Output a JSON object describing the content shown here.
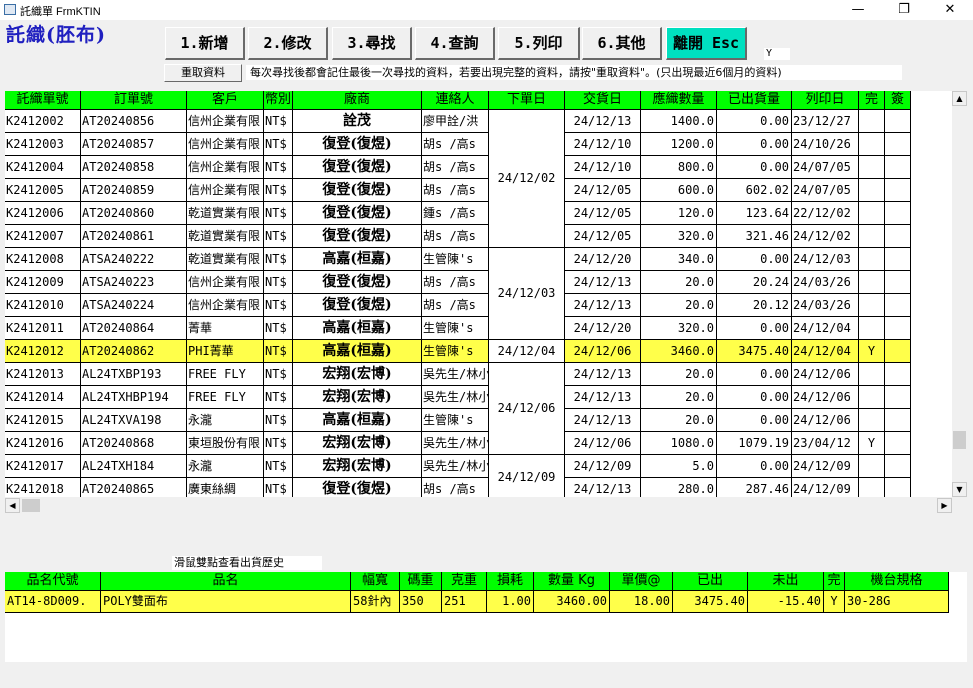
{
  "window": {
    "title": "託織單 FrmKTIN",
    "minimize": "—",
    "restore": "❐",
    "close": "✕"
  },
  "form_title": "託織(胚布)",
  "toolbar": {
    "buttons": [
      "1.新增",
      "2.修改",
      "3.尋找",
      "4.查詢",
      "5.列印",
      "6.其他",
      "離開 Esc"
    ],
    "y_label": "Y",
    "reload_label": "重取資料",
    "notice": "每次尋找後都會記住最後一次尋找的資料，若要出現完整的資料，請按\"重取資料\"。(只出現最近6個月的資料)"
  },
  "grid": {
    "headers": [
      "託織單號",
      "訂單號",
      "客戶",
      "幣別",
      "廠商",
      "連絡人",
      "下單日",
      "交貨日",
      "應織數量",
      "已出貨量",
      "列印日",
      "完",
      "簽"
    ],
    "order_date_groups": [
      {
        "date": "24/12/02",
        "start": 0,
        "count": 6
      },
      {
        "date": "24/12/03",
        "start": 6,
        "count": 4
      },
      {
        "date": "24/12/04",
        "start": 10,
        "count": 1
      },
      {
        "date": "24/12/06",
        "start": 11,
        "count": 4
      },
      {
        "date": "24/12/09",
        "start": 15,
        "count": 2
      }
    ],
    "rows": [
      {
        "no": "K2412002",
        "order": "AT20240856",
        "customer": "信州企業有限",
        "currency": "NT$",
        "factory": "詮茂",
        "contact": "廖甲詮/洪",
        "delivery": "24/12/13",
        "qty": "1400.0",
        "shipped": "0.00",
        "printed": "23/12/27",
        "done": "",
        "sign": ""
      },
      {
        "no": "K2412003",
        "order": "AT20240857",
        "customer": "信州企業有限",
        "currency": "NT$",
        "factory": "復登(復煜)",
        "contact": "胡s /高s",
        "delivery": "24/12/10",
        "qty": "1200.0",
        "shipped": "0.00",
        "printed": "24/10/26",
        "done": "",
        "sign": ""
      },
      {
        "no": "K2412004",
        "order": "AT20240858",
        "customer": "信州企業有限",
        "currency": "NT$",
        "factory": "復登(復煜)",
        "contact": "胡s /高s",
        "delivery": "24/12/10",
        "qty": "800.0",
        "shipped": "0.00",
        "printed": "24/07/05",
        "done": "",
        "sign": ""
      },
      {
        "no": "K2412005",
        "order": "AT20240859",
        "customer": "信州企業有限",
        "currency": "NT$",
        "factory": "復登(復煜)",
        "contact": "胡s /高s",
        "delivery": "24/12/05",
        "qty": "600.0",
        "shipped": "602.02",
        "printed": "24/07/05",
        "done": "",
        "sign": ""
      },
      {
        "no": "K2412006",
        "order": "AT20240860",
        "customer": "乾道實業有限",
        "currency": "NT$",
        "factory": "復登(復煜)",
        "contact": "鍾s /高s",
        "delivery": "24/12/05",
        "qty": "120.0",
        "shipped": "123.64",
        "printed": "22/12/02",
        "done": "",
        "sign": ""
      },
      {
        "no": "K2412007",
        "order": "AT20240861",
        "customer": "乾道實業有限",
        "currency": "NT$",
        "factory": "復登(復煜)",
        "contact": "胡s /高s",
        "delivery": "24/12/05",
        "qty": "320.0",
        "shipped": "321.46",
        "printed": "24/12/02",
        "done": "",
        "sign": ""
      },
      {
        "no": "K2412008",
        "order": "ATSA240222",
        "customer": "乾道實業有限",
        "currency": "NT$",
        "factory": "高嘉(桓嘉)",
        "contact": "生管陳's",
        "delivery": "24/12/20",
        "qty": "340.0",
        "shipped": "0.00",
        "printed": "24/12/03",
        "done": "",
        "sign": ""
      },
      {
        "no": "K2412009",
        "order": "ATSA240223",
        "customer": "信州企業有限",
        "currency": "NT$",
        "factory": "復登(復煜)",
        "contact": "胡s /高s",
        "delivery": "24/12/13",
        "qty": "20.0",
        "shipped": "20.24",
        "printed": "24/03/26",
        "done": "",
        "sign": ""
      },
      {
        "no": "K2412010",
        "order": "ATSA240224",
        "customer": "信州企業有限",
        "currency": "NT$",
        "factory": "復登(復煜)",
        "contact": "胡s /高s",
        "delivery": "24/12/13",
        "qty": "20.0",
        "shipped": "20.12",
        "printed": "24/03/26",
        "done": "",
        "sign": ""
      },
      {
        "no": "K2412011",
        "order": "AT20240864",
        "customer": "菁華",
        "currency": "NT$",
        "factory": "高嘉(桓嘉)",
        "contact": "生管陳's",
        "delivery": "24/12/20",
        "qty": "320.0",
        "shipped": "0.00",
        "printed": "24/12/04",
        "done": "",
        "sign": ""
      },
      {
        "no": "K2412012",
        "order": "AT20240862",
        "customer": "PHI菁華",
        "currency": "NT$",
        "factory": "高嘉(桓嘉)",
        "contact": "生管陳's",
        "delivery": "24/12/06",
        "qty": "3460.0",
        "shipped": "3475.40",
        "printed": "24/12/04",
        "done": "Y",
        "sign": ""
      },
      {
        "no": "K2412013",
        "order": "AL24TXBP193",
        "customer": "FREE FLY",
        "currency": "NT$",
        "factory": "宏翔(宏博)",
        "contact": "吳先生/林小",
        "delivery": "24/12/13",
        "qty": "20.0",
        "shipped": "0.00",
        "printed": "24/12/06",
        "done": "",
        "sign": ""
      },
      {
        "no": "K2412014",
        "order": "AL24TXHBP194",
        "customer": "FREE FLY",
        "currency": "NT$",
        "factory": "宏翔(宏博)",
        "contact": "吳先生/林小",
        "delivery": "24/12/13",
        "qty": "20.0",
        "shipped": "0.00",
        "printed": "24/12/06",
        "done": "",
        "sign": ""
      },
      {
        "no": "K2412015",
        "order": "AL24TXVA198",
        "customer": "永瀧",
        "currency": "NT$",
        "factory": "高嘉(桓嘉)",
        "contact": "生管陳's",
        "delivery": "24/12/13",
        "qty": "20.0",
        "shipped": "0.00",
        "printed": "24/12/06",
        "done": "",
        "sign": ""
      },
      {
        "no": "K2412016",
        "order": "AT20240868",
        "customer": "東垣股份有限",
        "currency": "NT$",
        "factory": "宏翔(宏博)",
        "contact": "吳先生/林小",
        "delivery": "24/12/06",
        "qty": "1080.0",
        "shipped": "1079.19",
        "printed": "23/04/12",
        "done": "Y",
        "sign": ""
      },
      {
        "no": "K2412017",
        "order": "AL24TXH184",
        "customer": "永瀧",
        "currency": "NT$",
        "factory": "宏翔(宏博)",
        "contact": "吳先生/林小",
        "delivery": "24/12/09",
        "qty": "5.0",
        "shipped": "0.00",
        "printed": "24/12/09",
        "done": "",
        "sign": ""
      },
      {
        "no": "K2412018",
        "order": "AT20240865",
        "customer": "廣東絲綢",
        "currency": "NT$",
        "factory": "復登(復煜)",
        "contact": "胡s /高s",
        "delivery": "24/12/13",
        "qty": "280.0",
        "shipped": "287.46",
        "printed": "24/12/09",
        "done": "",
        "sign": ""
      }
    ],
    "selected_index": 10,
    "scroll": {
      "up": "▲",
      "down": "▼",
      "left": "◀",
      "right": "▶"
    }
  },
  "detail": {
    "hint": "滑鼠雙點查看出貨歷史",
    "headers": [
      "品名代號",
      "品名",
      "幅寬",
      "碼重",
      "克重",
      "損耗",
      "數量 Kg",
      "單價@",
      "已出",
      "未出",
      "完",
      "機台規格"
    ],
    "rows": [
      {
        "code": "AT14-8D009.",
        "name": "POLY雙面布",
        "width": "58針內",
        "yard_weight": "350",
        "gram_weight": "251",
        "loss": "1.00",
        "qty_kg": "3460.00",
        "price": "18.00",
        "shipped": "3475.40",
        "unshipped": "-15.40",
        "done": "Y",
        "machine": "30-28G"
      }
    ]
  },
  "colors": {
    "header_bg": "#00ff00",
    "selected_row": "#ffff4a",
    "esc_button": "#00e0c0",
    "form_title": "#2020c0"
  }
}
